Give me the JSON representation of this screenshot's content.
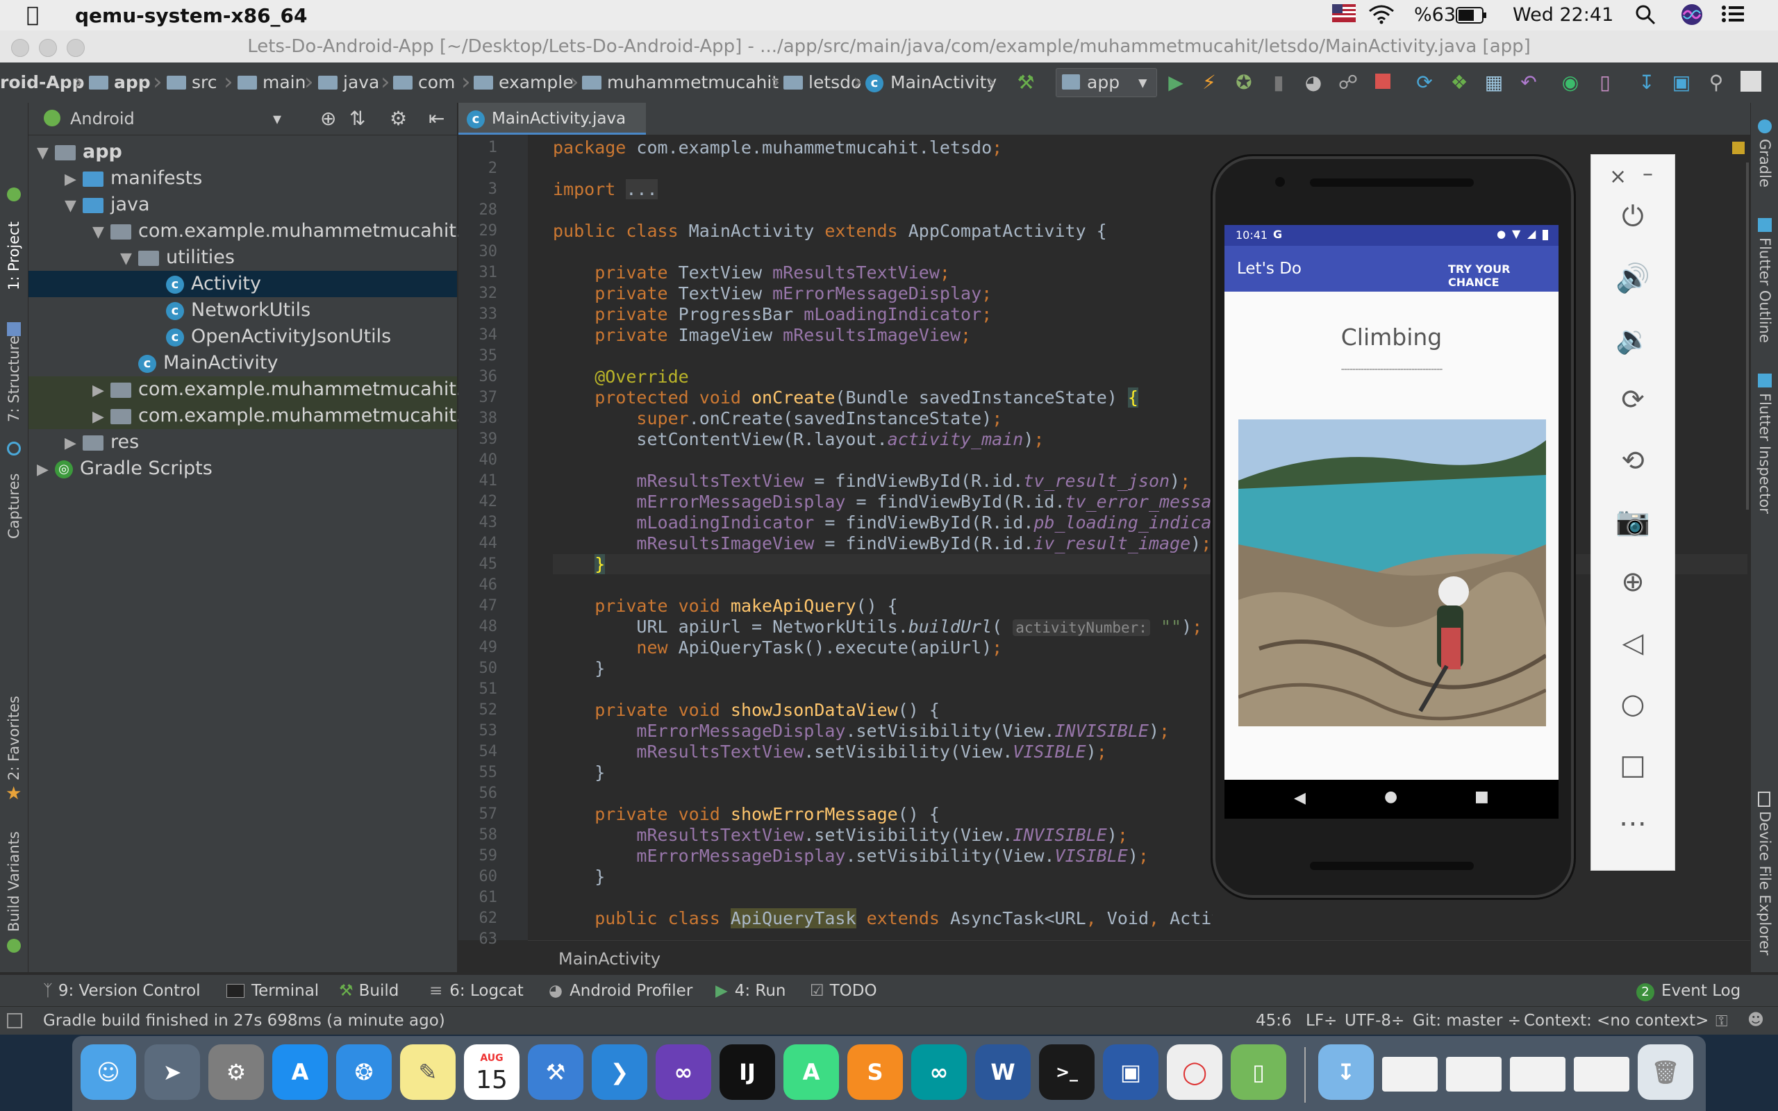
{
  "menubar": {
    "app_name": "qemu-system-x86_64",
    "battery": "%63",
    "clock": "Wed 22:41"
  },
  "window": {
    "title": "Lets-Do-Android-App [~/Desktop/Lets-Do-Android-App] - .../app/src/main/java/com/example/muhammetmucahit/letsdo/MainActivity.java [app]"
  },
  "navbar": {
    "crumbs": [
      "roid-App",
      "app",
      "src",
      "main",
      "java",
      "com",
      "example",
      "muhammetmucahit",
      "letsdo",
      "MainActivity"
    ],
    "run_config": "app"
  },
  "left_strip": {
    "tabs": [
      "1: Project",
      "7: Structure",
      "Captures",
      "2: Favorites",
      "Build Variants"
    ]
  },
  "project": {
    "view": "Android",
    "tree": [
      {
        "label": "app",
        "level": 0,
        "arrow": "▼",
        "icon": "folder"
      },
      {
        "label": "manifests",
        "level": 1,
        "arrow": "▶",
        "icon": "folder-blue"
      },
      {
        "label": "java",
        "level": 1,
        "arrow": "▼",
        "icon": "folder-blue"
      },
      {
        "label": "com.example.muhammetmucahit.lets",
        "level": 2,
        "arrow": "▼",
        "icon": "package"
      },
      {
        "label": "utilities",
        "level": 3,
        "arrow": "▼",
        "icon": "package"
      },
      {
        "label": "Activity",
        "level": 4,
        "arrow": "",
        "icon": "class",
        "selected": true
      },
      {
        "label": "NetworkUtils",
        "level": 4,
        "arrow": "",
        "icon": "class"
      },
      {
        "label": "OpenActivityJsonUtils",
        "level": 4,
        "arrow": "",
        "icon": "class"
      },
      {
        "label": "MainActivity",
        "level": 3,
        "arrow": "",
        "icon": "class"
      },
      {
        "label": "com.example.muhammetmucahit.lets",
        "level": 2,
        "arrow": "▶",
        "icon": "package",
        "test": true
      },
      {
        "label": "com.example.muhammetmucahit.lets",
        "level": 2,
        "arrow": "▶",
        "icon": "package",
        "test": true
      },
      {
        "label": "res",
        "level": 1,
        "arrow": "▶",
        "icon": "folder"
      },
      {
        "label": "Gradle Scripts",
        "level": 0,
        "arrow": "▶",
        "icon": "gradle"
      }
    ]
  },
  "editor": {
    "tab_label": "MainActivity.java",
    "breadcrumb": "MainActivity",
    "line_numbers": [
      "1",
      "2",
      "3",
      "28",
      "29",
      "30",
      "31",
      "32",
      "33",
      "34",
      "35",
      "36",
      "37",
      "38",
      "39",
      "40",
      "41",
      "42",
      "43",
      "44",
      "45",
      "46",
      "47",
      "48",
      "49",
      "50",
      "51",
      "52",
      "53",
      "54",
      "55",
      "56",
      "57",
      "58",
      "59",
      "60",
      "61",
      "62",
      "63"
    ],
    "param_hint": "activityNumber:"
  },
  "right_strip": {
    "tabs": [
      "Gradle",
      "Flutter Outline",
      "Flutter Inspector",
      "Device File Explorer"
    ]
  },
  "emulator": {
    "status_time": "10:41",
    "status_g": "G",
    "app_title": "Let's Do",
    "action": "TRY YOUR CHANCE",
    "activity_title": "Climbing",
    "divider": "------------------------------------"
  },
  "bottom_tools": {
    "items": [
      "9: Version Control",
      "Terminal",
      "Build",
      "6: Logcat",
      "Android Profiler",
      "4: Run",
      "TODO"
    ],
    "event_log_count": "2",
    "event_log": "Event Log"
  },
  "status": {
    "message": "Gradle build finished in 27s 698ms (a minute ago)",
    "position": "45:6",
    "line_sep": "LF÷",
    "encoding": "UTF-8÷",
    "git": "Git: master ÷",
    "context": "Context: <no context>"
  },
  "dock": {
    "calendar_month": "AUG",
    "calendar_day": "15"
  },
  "colors": {
    "ide_bg": "#2b2b2b",
    "keyword": "#cc7832",
    "method": "#ffc66d",
    "field": "#9876aa",
    "app_bar": "#3f51b5"
  }
}
